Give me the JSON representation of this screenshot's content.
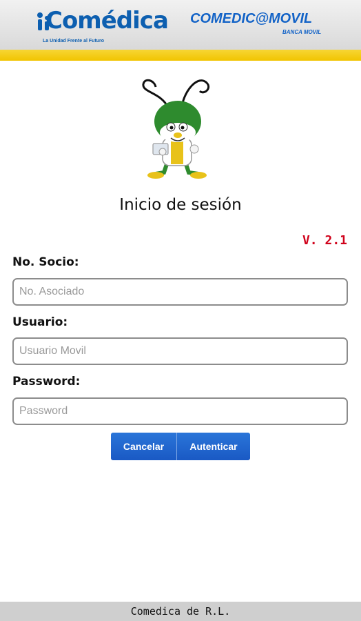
{
  "header": {
    "logo_text": "Comédica",
    "logo_tagline": "La Unidad Frente al Futuro",
    "app_title": "COMEDIC@MOVIL",
    "app_subtitle": "BANCA MOVIL"
  },
  "login": {
    "title": "Inicio de sesión",
    "version": "V. 2.1",
    "fields": [
      {
        "label": "No. Socio:",
        "placeholder": "No. Asociado",
        "value": ""
      },
      {
        "label": "Usuario:",
        "placeholder": "Usuario Movil",
        "value": ""
      },
      {
        "label": "Password:",
        "placeholder": "Password",
        "value": ""
      }
    ],
    "buttons": {
      "cancel": "Cancelar",
      "auth": "Autenticar"
    }
  },
  "footer": {
    "text": "Comedica de R.L."
  },
  "colors": {
    "brand_blue": "#0d5fb0",
    "stripe_yellow": "#f1c400",
    "button_blue": "#1a59c4",
    "version_red": "#d0021b",
    "mascot_green": "#2e8b2e"
  }
}
